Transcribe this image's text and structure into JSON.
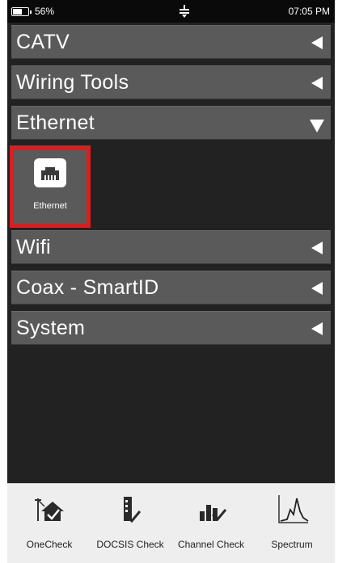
{
  "status": {
    "battery": "56%",
    "battery_level": 0.56,
    "time": "07:05 PM"
  },
  "menu": [
    {
      "label": "CATV",
      "expanded": false
    },
    {
      "label": "Wiring Tools",
      "expanded": false
    },
    {
      "label": "Ethernet",
      "expanded": true
    },
    {
      "label": "Wifi",
      "expanded": false
    },
    {
      "label": "Coax - SmartID",
      "expanded": false
    },
    {
      "label": "System",
      "expanded": false
    }
  ],
  "ethernet_tile": {
    "label": "Ethernet",
    "icon": "ethernet-port-icon",
    "highlight_color": "#e01b1b"
  },
  "toolbar": [
    {
      "label": "OneCheck",
      "icon": "onecheck-house-icon"
    },
    {
      "label": "DOCSIS Check",
      "icon": "docsis-check-icon"
    },
    {
      "label": "Channel Check",
      "icon": "channel-check-icon"
    },
    {
      "label": "Spectrum",
      "icon": "spectrum-icon"
    }
  ],
  "colors": {
    "background": "#222222",
    "menu_bar": "#5a5a5a",
    "toolbar": "#eeeeee",
    "accent_red": "#e01b1b"
  }
}
